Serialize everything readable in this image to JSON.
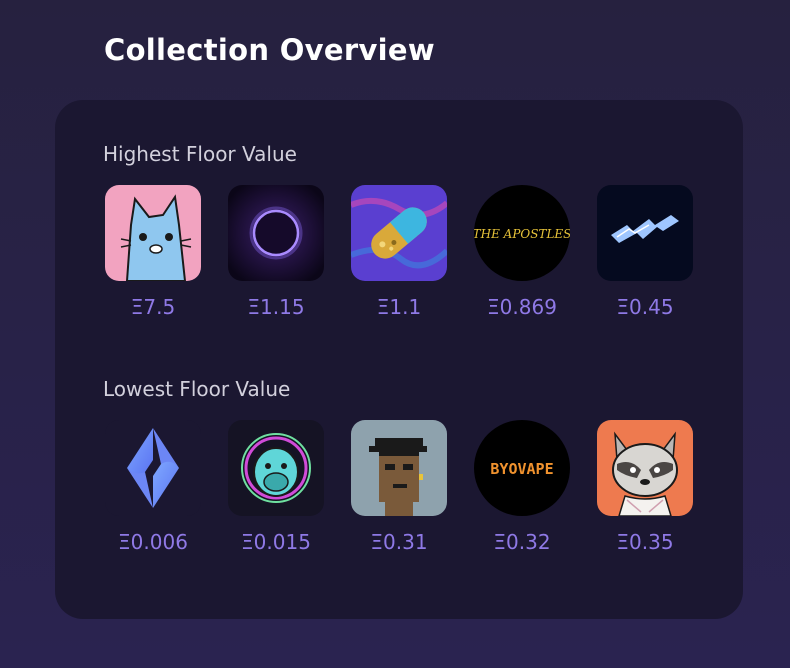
{
  "page_title": "Collection Overview",
  "sections": [
    {
      "title": "Highest Floor Value",
      "items": [
        {
          "price": "Ξ7.5",
          "icon": "blue-cat-avatar",
          "bg": "#f2a3c0"
        },
        {
          "price": "Ξ1.15",
          "icon": "purple-orb",
          "bg": "#1a1032"
        },
        {
          "price": "Ξ1.1",
          "icon": "gold-pill",
          "bg": "#5a3fd0"
        },
        {
          "price": "Ξ0.869",
          "icon": "the-apostles-logo",
          "label": "THE APOSTLES",
          "bg": "#000000"
        },
        {
          "price": "Ξ0.45",
          "icon": "blue-lightning",
          "bg": "#050a1f"
        }
      ]
    },
    {
      "title": "Lowest Floor Value",
      "items": [
        {
          "price": "Ξ0.006",
          "icon": "ens-logo",
          "bg": "#1b1731"
        },
        {
          "price": "Ξ0.015",
          "icon": "neon-ape",
          "bg": "#151324"
        },
        {
          "price": "Ξ0.31",
          "icon": "pixel-punk",
          "bg": "#8ea2ad"
        },
        {
          "price": "Ξ0.32",
          "icon": "byovape-logo",
          "label": "BYOVAPE",
          "bg": "#000000"
        },
        {
          "price": "Ξ0.35",
          "icon": "raccoon-avatar",
          "bg": "#ee7a4f"
        }
      ]
    }
  ]
}
